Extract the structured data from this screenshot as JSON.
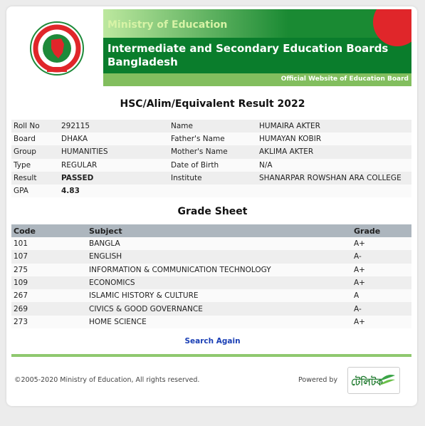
{
  "header": {
    "ministry": "Ministry of Education",
    "board_name": "Intermediate and Secondary Education Boards Bangladesh",
    "footer_label": "Official Website of Education Board"
  },
  "result_title": "HSC/Alim/Equivalent Result 2022",
  "student": {
    "roll_label": "Roll No",
    "roll": "292115",
    "board_label": "Board",
    "board": "DHAKA",
    "group_label": "Group",
    "group": "HUMANITIES",
    "type_label": "Type",
    "type": "REGULAR",
    "result_label": "Result",
    "result": "PASSED",
    "gpa_label": "GPA",
    "gpa": "4.83",
    "name_label": "Name",
    "name": "HUMAIRA AKTER",
    "father_label": "Father's Name",
    "father": "HUMAYAN KOBIR",
    "mother_label": "Mother's Name",
    "mother": "AKLIMA AKTER",
    "dob_label": "Date of Birth",
    "dob": "N/A",
    "institute_label": "Institute",
    "institute": "SHANARPAR ROWSHAN ARA COLLEGE"
  },
  "grade_sheet": {
    "title": "Grade Sheet",
    "headers": [
      "Code",
      "Subject",
      "Grade"
    ],
    "rows": [
      [
        "101",
        "BANGLA",
        "A+"
      ],
      [
        "107",
        "ENGLISH",
        "A-"
      ],
      [
        "275",
        "INFORMATION & COMMUNICATION TECHNOLOGY",
        "A+"
      ],
      [
        "109",
        "ECONOMICS",
        "A+"
      ],
      [
        "267",
        "ISLAMIC HISTORY & CULTURE",
        "A"
      ],
      [
        "269",
        "CIVICS & GOOD GOVERNANCE",
        "A-"
      ],
      [
        "273",
        "HOME SCIENCE",
        "A+"
      ]
    ]
  },
  "search_again": "Search Again",
  "footer": {
    "copyright": "©2005-2020 Ministry of Education, All rights reserved.",
    "powered_by": "Powered by",
    "logo_text": "টেলিটক"
  },
  "colors": {
    "accent_green": "#0a7d2c",
    "light_green": "#82be5e",
    "link_blue": "#1a3fb5"
  }
}
